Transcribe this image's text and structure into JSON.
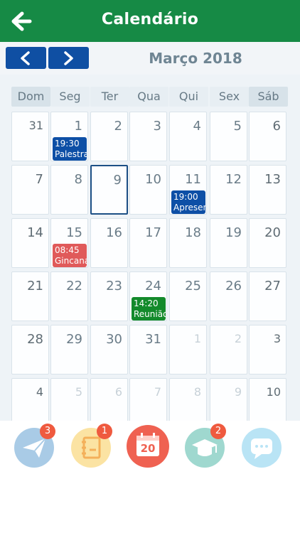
{
  "header": {
    "title": "Calendário",
    "back_icon": "arrow-left-icon"
  },
  "calendar": {
    "month_label": "Março 2018",
    "prev_icon": "chevron-left-icon",
    "next_icon": "chevron-right-icon",
    "weekdays": [
      "Dom",
      "Seg",
      "Ter",
      "Qua",
      "Qui",
      "Sex",
      "Sáb"
    ],
    "weeks": [
      [
        {
          "day": "31",
          "muted": true
        },
        {
          "day": "1"
        },
        {
          "day": "2"
        },
        {
          "day": "3"
        },
        {
          "day": "4"
        },
        {
          "day": "5"
        },
        {
          "day": "6"
        }
      ],
      [
        {
          "day": "7"
        },
        {
          "day": "8"
        },
        {
          "day": "9",
          "today": true
        },
        {
          "day": "10"
        },
        {
          "day": "11"
        },
        {
          "day": "12"
        },
        {
          "day": "13"
        }
      ],
      [
        {
          "day": "14"
        },
        {
          "day": "15"
        },
        {
          "day": "16"
        },
        {
          "day": "17"
        },
        {
          "day": "18"
        },
        {
          "day": "19"
        },
        {
          "day": "20"
        }
      ],
      [
        {
          "day": "21"
        },
        {
          "day": "22"
        },
        {
          "day": "23"
        },
        {
          "day": "24"
        },
        {
          "day": "25"
        },
        {
          "day": "26"
        },
        {
          "day": "27"
        }
      ],
      [
        {
          "day": "28"
        },
        {
          "day": "29"
        },
        {
          "day": "30"
        },
        {
          "day": "31"
        },
        {
          "day": "1",
          "muted": true
        },
        {
          "day": "2",
          "muted": true
        },
        {
          "day": "3",
          "muted": true
        }
      ],
      [
        {
          "day": "4",
          "muted": true
        },
        {
          "day": "5",
          "muted": true
        },
        {
          "day": "6",
          "muted": true
        },
        {
          "day": "7",
          "muted": true
        },
        {
          "day": "8",
          "muted": true
        },
        {
          "day": "9",
          "muted": true
        },
        {
          "day": "10",
          "muted": true
        }
      ]
    ],
    "events": [
      {
        "week": 0,
        "col": 1,
        "time": "19:30",
        "title": "Palestra",
        "color": "#0d4fa6"
      },
      {
        "week": 1,
        "col": 4,
        "time": "19:00",
        "title": "Apresen",
        "color": "#0d4fa6"
      },
      {
        "week": 2,
        "col": 1,
        "time": "08:45",
        "title": "Gincana",
        "color": "#e05a5a"
      },
      {
        "week": 3,
        "col": 3,
        "time": "14:20",
        "title": "Reunião",
        "color": "#138a2b"
      }
    ]
  },
  "tabbar": [
    {
      "name": "messages",
      "icon": "paper-plane-icon",
      "color": "#a9cbe6",
      "badge": "3"
    },
    {
      "name": "notebook",
      "icon": "notebook-icon",
      "color": "#fbe3a3",
      "badge": "1"
    },
    {
      "name": "calendar",
      "icon": "calendar-icon",
      "color": "#ef6151",
      "day": "20",
      "active": true
    },
    {
      "name": "grades",
      "icon": "graduation-cap-icon",
      "color": "#9fd8cf",
      "badge": "2"
    },
    {
      "name": "chat",
      "icon": "chat-bubble-icon",
      "color": "#b9e4f5"
    }
  ],
  "colors": {
    "brand_green": "#168a45",
    "nav_blue": "#0f4fa3",
    "badge_red": "#ef5a3f"
  }
}
